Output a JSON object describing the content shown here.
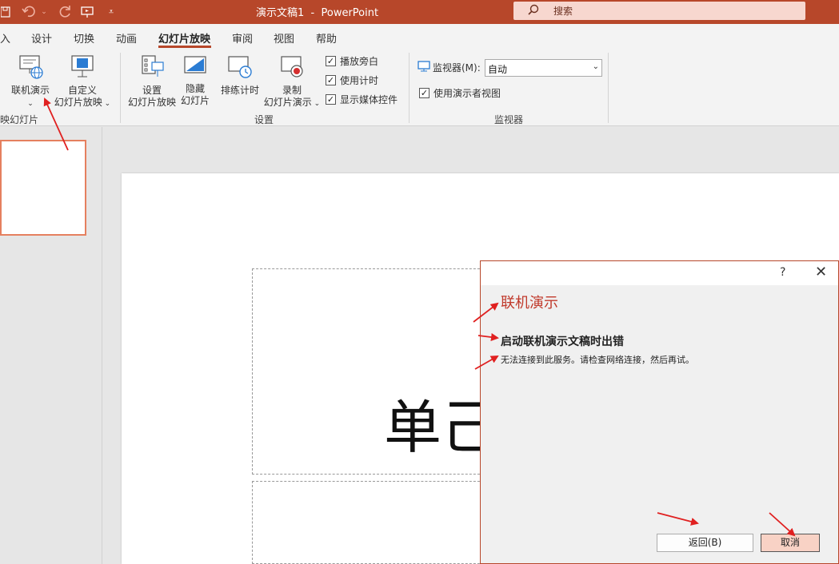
{
  "titlebar": {
    "title": "演示文稿1  -  PowerPoint",
    "search_placeholder": "搜索",
    "qat_icons": [
      "save-icon",
      "undo-icon",
      "redo-icon",
      "present-icon",
      "customize-icon"
    ]
  },
  "tabs": [
    {
      "label": "入"
    },
    {
      "label": "设计"
    },
    {
      "label": "切换"
    },
    {
      "label": "动画"
    },
    {
      "label": "幻灯片放映",
      "active": true
    },
    {
      "label": "审阅"
    },
    {
      "label": "视图"
    },
    {
      "label": "帮助"
    }
  ],
  "ribbon": {
    "group_start": {
      "label": "映幻灯片",
      "online_present": "联机演示",
      "online_present_dropdown": "⌄",
      "custom_show_line1": "自定义",
      "custom_show_line2": "幻灯片放映"
    },
    "group_setup": {
      "label": "设置",
      "setup_line1": "设置",
      "setup_line2": "幻灯片放映",
      "hide_line1": "隐藏",
      "hide_line2": "幻灯片",
      "rehearse": "排练计时",
      "record_line1": "录制",
      "record_line2": "幻灯片演示",
      "play_narrations": "播放旁白",
      "use_timings": "使用计时",
      "show_media_controls": "显示媒体控件"
    },
    "group_monitors": {
      "label": "监视器",
      "monitor_label": "监视器(M):",
      "monitor_value": "自动",
      "presenter_view": "使用演示者视图"
    }
  },
  "slide": {
    "title_text": "单己"
  },
  "dialog": {
    "help": "?",
    "close": "✕",
    "heading": "联机演示",
    "error_title": "启动联机演示文稿时出错",
    "error_message": "无法连接到此服务。请检查网络连接，然后再试。",
    "back_button": "返回(B)",
    "cancel_button": "取消"
  },
  "colors": {
    "brand": "#b7472a",
    "arrow": "#e02020",
    "thumb_border": "#e5805f"
  }
}
